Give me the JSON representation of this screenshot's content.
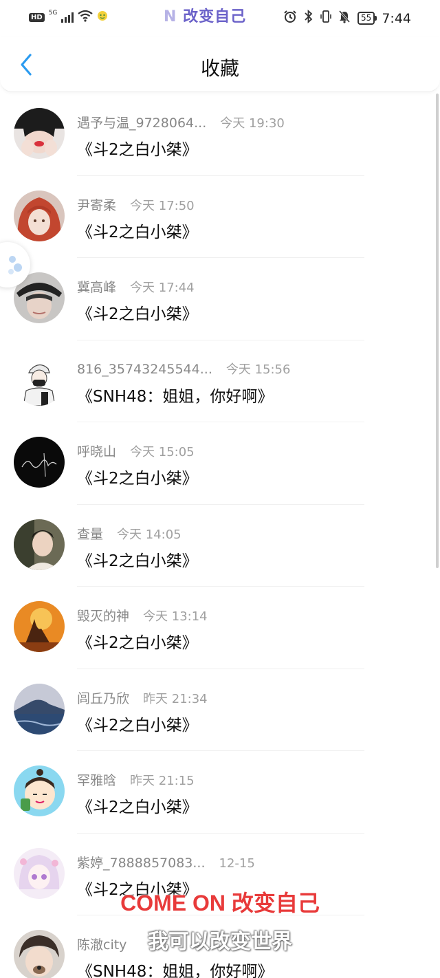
{
  "status_bar": {
    "hd": "HD",
    "signal": "5G",
    "center_text_faded": "N",
    "center_text": " 改变自己",
    "battery": "55",
    "time": "7:44"
  },
  "nav": {
    "back_icon": "chevron-left-icon",
    "title": "收藏"
  },
  "items": [
    {
      "username": "遇予与温_9728064...",
      "time": "今天 19:30",
      "title": "《斗2之白小桀》",
      "avatar": "avatar-0"
    },
    {
      "username": "尹寄柔",
      "time": "今天 17:50",
      "title": "《斗2之白小桀》",
      "avatar": "avatar-1"
    },
    {
      "username": "冀高峰",
      "time": "今天 17:44",
      "title": "《斗2之白小桀》",
      "avatar": "avatar-2"
    },
    {
      "username": "816_35743245544...",
      "time": "今天 15:56",
      "title": "《SNH48：姐姐，你好啊》",
      "avatar": "avatar-3"
    },
    {
      "username": "呼晓山",
      "time": "今天 15:05",
      "title": "《斗2之白小桀》",
      "avatar": "avatar-4"
    },
    {
      "username": "查量",
      "time": "今天 14:05",
      "title": "《斗2之白小桀》",
      "avatar": "avatar-5"
    },
    {
      "username": "毁灭的神",
      "time": "今天 13:14",
      "title": "《斗2之白小桀》",
      "avatar": "avatar-6"
    },
    {
      "username": "闾丘乃欣",
      "time": "昨天 21:34",
      "title": "《斗2之白小桀》",
      "avatar": "avatar-7"
    },
    {
      "username": "罕雅晗",
      "time": "昨天 21:15",
      "title": "《斗2之白小桀》",
      "avatar": "avatar-8"
    },
    {
      "username": "紫婷_7888857083...",
      "time": "12-15",
      "title": "《斗2之白小桀》",
      "avatar": "avatar-9"
    },
    {
      "username": "陈澈city",
      "time": "",
      "title": "《SNH48：姐姐，你好啊》",
      "avatar": "avatar-10"
    }
  ],
  "overlay": {
    "caption_red": "COME ON 改变自己",
    "caption_white": "我可以改变世界"
  },
  "colors": {
    "accent_blue": "#2b9bf0",
    "caption_red": "#e83a3a",
    "caption_purple": "#6b62c9"
  }
}
